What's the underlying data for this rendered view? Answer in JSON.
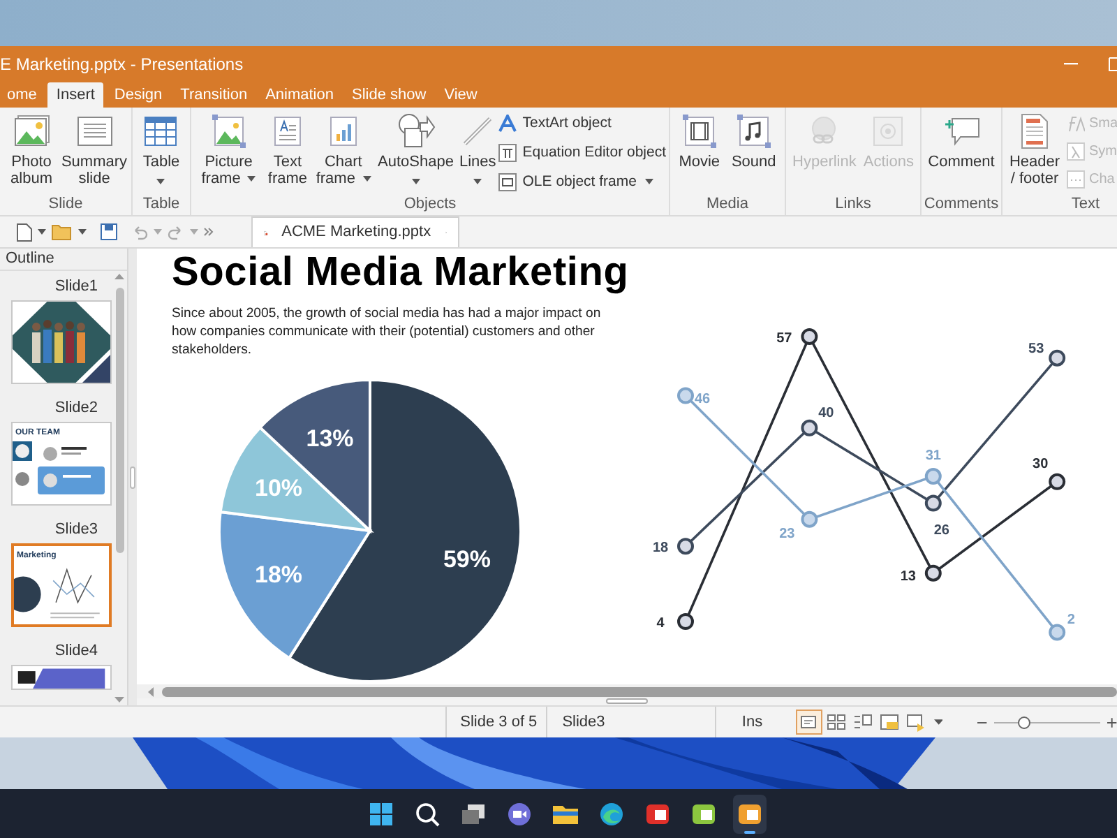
{
  "window": {
    "title": "E Marketing.pptx - Presentations"
  },
  "ribbon_tabs": [
    {
      "label": "ome",
      "selected": false
    },
    {
      "label": "Insert",
      "selected": true
    },
    {
      "label": "Design",
      "selected": false
    },
    {
      "label": "Transition",
      "selected": false
    },
    {
      "label": "Animation",
      "selected": false
    },
    {
      "label": "Slide show",
      "selected": false
    },
    {
      "label": "View",
      "selected": false
    }
  ],
  "ribbon_groups": [
    {
      "label": "Slide",
      "buttons": [
        {
          "kind": "large",
          "label": "Photo album",
          "disabled": false
        },
        {
          "kind": "large",
          "label": "Summary slide",
          "disabled": false
        }
      ]
    },
    {
      "label": "Table",
      "buttons": [
        {
          "kind": "large",
          "label": "Table",
          "disabled": false,
          "dropdown": true
        }
      ]
    },
    {
      "label": "Objects",
      "buttons": [
        {
          "kind": "large",
          "label": "Picture frame",
          "disabled": false,
          "dropdown": true
        },
        {
          "kind": "large",
          "label": "Text frame",
          "disabled": false
        },
        {
          "kind": "large",
          "label": "Chart frame",
          "disabled": false,
          "dropdown": true
        },
        {
          "kind": "large",
          "label": "AutoShape",
          "disabled": false,
          "dropdown": true
        },
        {
          "kind": "large",
          "label": "Lines",
          "disabled": false,
          "dropdown": true
        },
        {
          "kind": "small",
          "label": "TextArt object",
          "disabled": false
        },
        {
          "kind": "small",
          "label": "Equation Editor object",
          "disabled": false
        },
        {
          "kind": "small",
          "label": "OLE object frame",
          "disabled": false,
          "dropdown": true
        }
      ]
    },
    {
      "label": "Media",
      "buttons": [
        {
          "kind": "large",
          "label": "Movie",
          "disabled": false
        },
        {
          "kind": "large",
          "label": "Sound",
          "disabled": false
        }
      ]
    },
    {
      "label": "Links",
      "buttons": [
        {
          "kind": "large",
          "label": "Hyperlink",
          "disabled": true
        },
        {
          "kind": "large",
          "label": "Actions",
          "disabled": true
        }
      ]
    },
    {
      "label": "Comments",
      "buttons": [
        {
          "kind": "large",
          "label": "Comment",
          "disabled": false
        }
      ]
    },
    {
      "label": "Text",
      "buttons": [
        {
          "kind": "large",
          "label": "Header / footer",
          "disabled": false
        },
        {
          "kind": "small",
          "label": "Sma",
          "disabled": true
        },
        {
          "kind": "small",
          "label": "Sym",
          "disabled": true
        },
        {
          "kind": "small",
          "label": "Cha",
          "disabled": true
        }
      ]
    }
  ],
  "document_tab": {
    "label": "ACME Marketing.pptx"
  },
  "outline": {
    "label": "Outline"
  },
  "slides": [
    {
      "label": "Slide1",
      "selected": false
    },
    {
      "label": "Slide2",
      "selected": false,
      "thumb_title": "OUR TEAM"
    },
    {
      "label": "Slide3",
      "selected": true,
      "thumb_title": "Marketing"
    },
    {
      "label": "Slide4",
      "selected": false
    }
  ],
  "slide": {
    "title": "Social Media Marketing",
    "body": "Since about 2005, the growth of social media has had a major impact on how companies communicate with their (potential) customers and other stakeholders.",
    "pie_chart": {
      "chart_data": {
        "type": "pie",
        "values": [
          59,
          18,
          10,
          13
        ],
        "colors": [
          "#2d3e50",
          "#6b9fd3",
          "#8ec6d9",
          "#475a7b"
        ],
        "value_labels": [
          "59%",
          "18%",
          "10%",
          "13%"
        ]
      }
    },
    "line_chart": {
      "chart_data": {
        "type": "line",
        "data_labels": true,
        "series": [
          {
            "color": "#2a2e35",
            "marker": "circle",
            "values": [
              4,
              57,
              13,
              30
            ]
          },
          {
            "color": "#3d4a5c",
            "marker": "circle",
            "values": [
              18,
              40,
              26,
              53
            ]
          },
          {
            "color": "#7fa4c9",
            "marker": "circle",
            "values": [
              46,
              23,
              31,
              2
            ]
          }
        ]
      }
    }
  },
  "status_bar": {
    "position": "Slide 3 of 5",
    "slide_name": "Slide3",
    "mode": "Ins",
    "views": [
      {
        "selected": true
      },
      {
        "selected": false
      },
      {
        "selected": false
      },
      {
        "selected": false
      },
      {
        "selected": false
      }
    ],
    "zoom": {
      "level": 0.28
    }
  },
  "taskbar": {
    "apps": [
      {
        "selected": false
      },
      {
        "selected": false
      },
      {
        "selected": false
      },
      {
        "selected": false
      },
      {
        "selected": false
      },
      {
        "selected": false
      },
      {
        "selected": false
      },
      {
        "selected": false
      },
      {
        "selected": true
      }
    ]
  }
}
